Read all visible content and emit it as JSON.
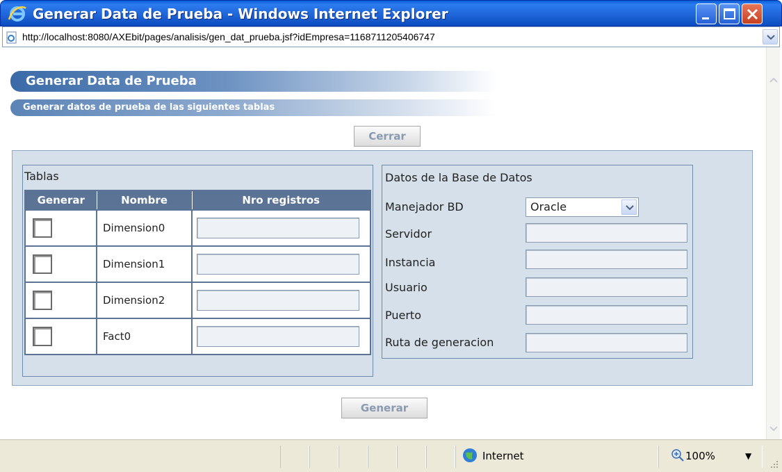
{
  "window": {
    "title": "Generar Data de Prueba - Windows Internet Explorer",
    "url": "http://localhost:8080/AXEbit/pages/analisis/gen_dat_prueba.jsf?idEmpresa=1168711205406747"
  },
  "page": {
    "header_title": "Generar Data de Prueba",
    "header_subtitle": "Generar datos de prueba de las siguientes tablas",
    "close_button": "Cerrar",
    "generate_button": "Generar"
  },
  "tablas": {
    "legend": "Tablas",
    "columns": [
      "Generar",
      "Nombre",
      "Nro registros"
    ],
    "rows": [
      {
        "name": "Dimension0",
        "checked": false,
        "records": ""
      },
      {
        "name": "Dimension1",
        "checked": false,
        "records": ""
      },
      {
        "name": "Dimension2",
        "checked": false,
        "records": ""
      },
      {
        "name": "Fact0",
        "checked": false,
        "records": ""
      }
    ]
  },
  "database": {
    "legend": "Datos de la Base de Datos",
    "manejador_label": "Manejador BD",
    "manejador_value": "Oracle",
    "servidor_label": "Servidor",
    "instancia_label": "Instancia",
    "usuario_label": "Usuario",
    "puerto_label": "Puerto",
    "ruta_label": "Ruta de generacion"
  },
  "statusbar": {
    "zone": "Internet",
    "zoom": "100%"
  },
  "colors": {
    "titlebar": "#1e64d6",
    "panel": "#d5e0ea",
    "grid_header": "#5b7496"
  }
}
